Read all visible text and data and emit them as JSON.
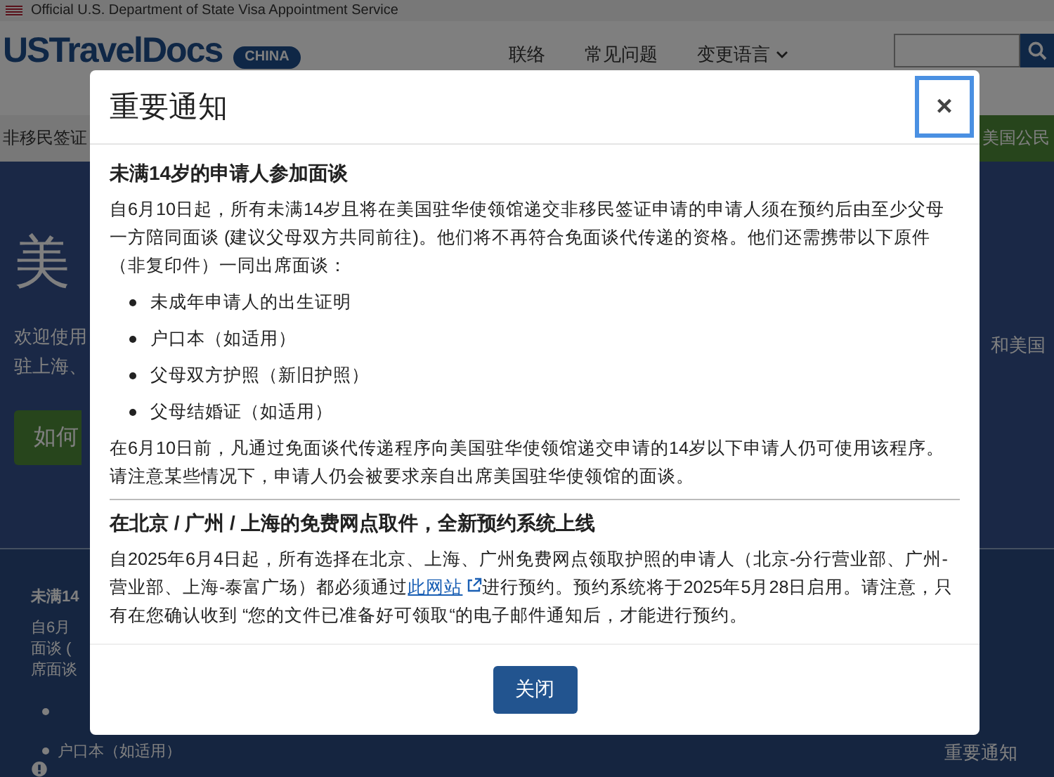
{
  "banner": {
    "text": "Official U.S. Department of State Visa Appointment Service"
  },
  "header": {
    "logo": "USTravelDocs",
    "badge": "CHINA",
    "links": [
      {
        "label": "联络",
        "kind": "plain"
      },
      {
        "label": "常见问题",
        "kind": "plain"
      },
      {
        "label": "变更语言",
        "kind": "dropdown"
      }
    ]
  },
  "nav": {
    "left": "非移民签证",
    "right": "美国公民"
  },
  "hero": {
    "title": "美",
    "lines": [
      "欢迎使用",
      "驻上海、"
    ],
    "right_text": "和美国",
    "button": "如何"
  },
  "notice_section": {
    "title": "未满14",
    "lines": [
      "自6月",
      "面谈 (",
      "席面谈"
    ],
    "bullets": [
      "户口本（如适用）"
    ]
  },
  "bottom_tab": "重要通知",
  "modal": {
    "title": "重要通知",
    "close": "×",
    "sections": [
      {
        "heading": "未满14岁的申请人参加面谈",
        "blocks": [
          {
            "kind": "paragraph",
            "text": "自6月10日起，所有未满14岁且将在美国驻华使领馆递交非移民签证申请的申请人须在预约后由至少父母一方陪同面谈 (建议父母双方共同前往)。他们将不再符合免面谈代传递的资格。他们还需携带以下原件（非复印件）一同出席面谈："
          },
          {
            "kind": "list",
            "items": [
              "未成年申请人的出生证明",
              "户口本（如适用）",
              "父母双方护照（新旧护照）",
              "父母结婚证（如适用）"
            ]
          },
          {
            "kind": "paragraph",
            "text": "在6月10日前，凡通过免面谈代传递程序向美国驻华使领馆递交申请的14岁以下申请人仍可使用该程序。请注意某些情况下，申请人仍会被要求亲自出席美国驻华使领馆的面谈。"
          }
        ]
      },
      {
        "heading": "在北京 / 广州 / 上海的免费网点取件，全新预约系统上线",
        "blocks": [
          {
            "kind": "link_paragraph",
            "before": "自2025年6月4日起，所有选择在北京、上海、广州免费网点领取护照的申请人（北京-分行营业部、广州-营业部、上海-泰富广场）都必须通过",
            "link": "此网站",
            "after": "进行预约。预约系统将于2025年5月28日启用。请注意，只有在您确认收到 “您的文件已准备好可领取“的电子邮件通知后，才能进行预约。"
          }
        ]
      }
    ],
    "button": "关闭"
  }
}
